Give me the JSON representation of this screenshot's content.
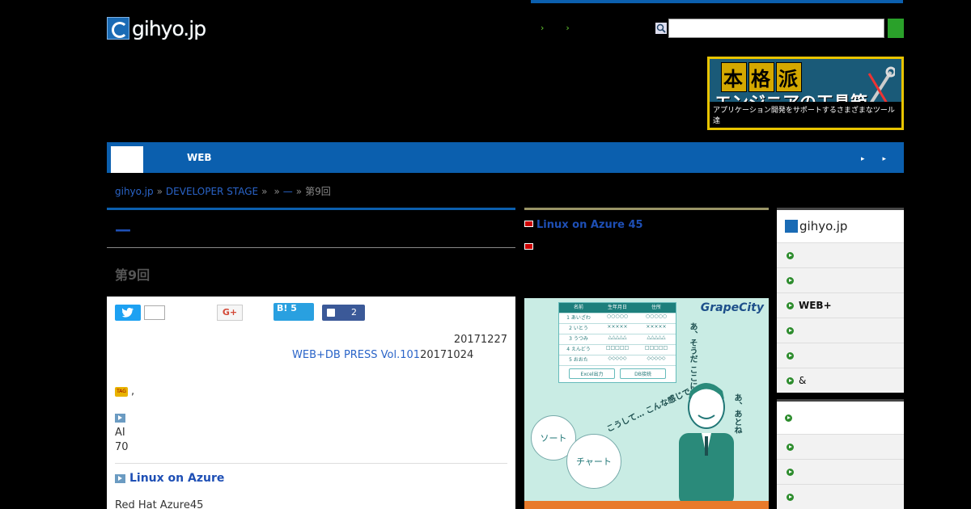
{
  "header": {
    "logo_text": "gihyo.jp",
    "top_links": [
      "",
      ""
    ],
    "search_placeholder": "",
    "search_button_label": ""
  },
  "banner": {
    "line1_chars": [
      "本",
      "格",
      "派"
    ],
    "line2": "エンジニアの工具箱",
    "line3": "アプリケーション開発をサポートするさまざまなツール達"
  },
  "nav": {
    "items": [
      "",
      "",
      "WEB",
      ""
    ],
    "right": [
      "",
      ""
    ]
  },
  "breadcrumb": {
    "items": [
      "gihyo.jp",
      "DEVELOPER STAGE",
      "",
      "—"
    ],
    "current": "第9回"
  },
  "article": {
    "title": "—",
    "subtitle": "第9回",
    "twitter_label": "",
    "twitter_count": "",
    "gplus_label": "G+",
    "hatena_label": "B! 5",
    "fb_count": "2",
    "date": "20171227",
    "magazine": "WEB+DB PRESS Vol.101",
    "magazine_date": "20171024",
    "tags_text": ",",
    "body_line1": "AI",
    "body_line2": "70",
    "section_heading": "Linux on Azure",
    "body_text2": "Red Hat Azure45"
  },
  "news": {
    "items": [
      "Linux on Azure 45",
      ""
    ]
  },
  "ad": {
    "brand": "GrapeCity",
    "table_headers": [
      "名前",
      "生年月日",
      "住所"
    ],
    "table_rows": [
      [
        "1 あいざわ",
        "○○○○○",
        "○○○○○"
      ],
      [
        "2 いとう",
        "×××××",
        "×××××"
      ],
      [
        "3 うつみ",
        "△△△△△",
        "△△△△△"
      ],
      [
        "4 えんどう",
        "□□□□□",
        "□□□□□"
      ],
      [
        "5 おおた",
        "◇◇◇◇◇",
        "◇◇◇◇◇"
      ]
    ],
    "buttons": [
      "Excel出力",
      "DB接続"
    ],
    "bubble1": "ソート",
    "bubble2": "チャート",
    "speech1": "あ、そうだ ここにさ…",
    "speech2": "こうして… こんな感じで…",
    "speech3": "あ、あとね"
  },
  "sidebar": {
    "block1_logo": "gihyo.jp",
    "block1_items": [
      "",
      "",
      "WEB+",
      "",
      "",
      "&"
    ],
    "block2_title": "",
    "block2_items": [
      "",
      "",
      ""
    ]
  }
}
